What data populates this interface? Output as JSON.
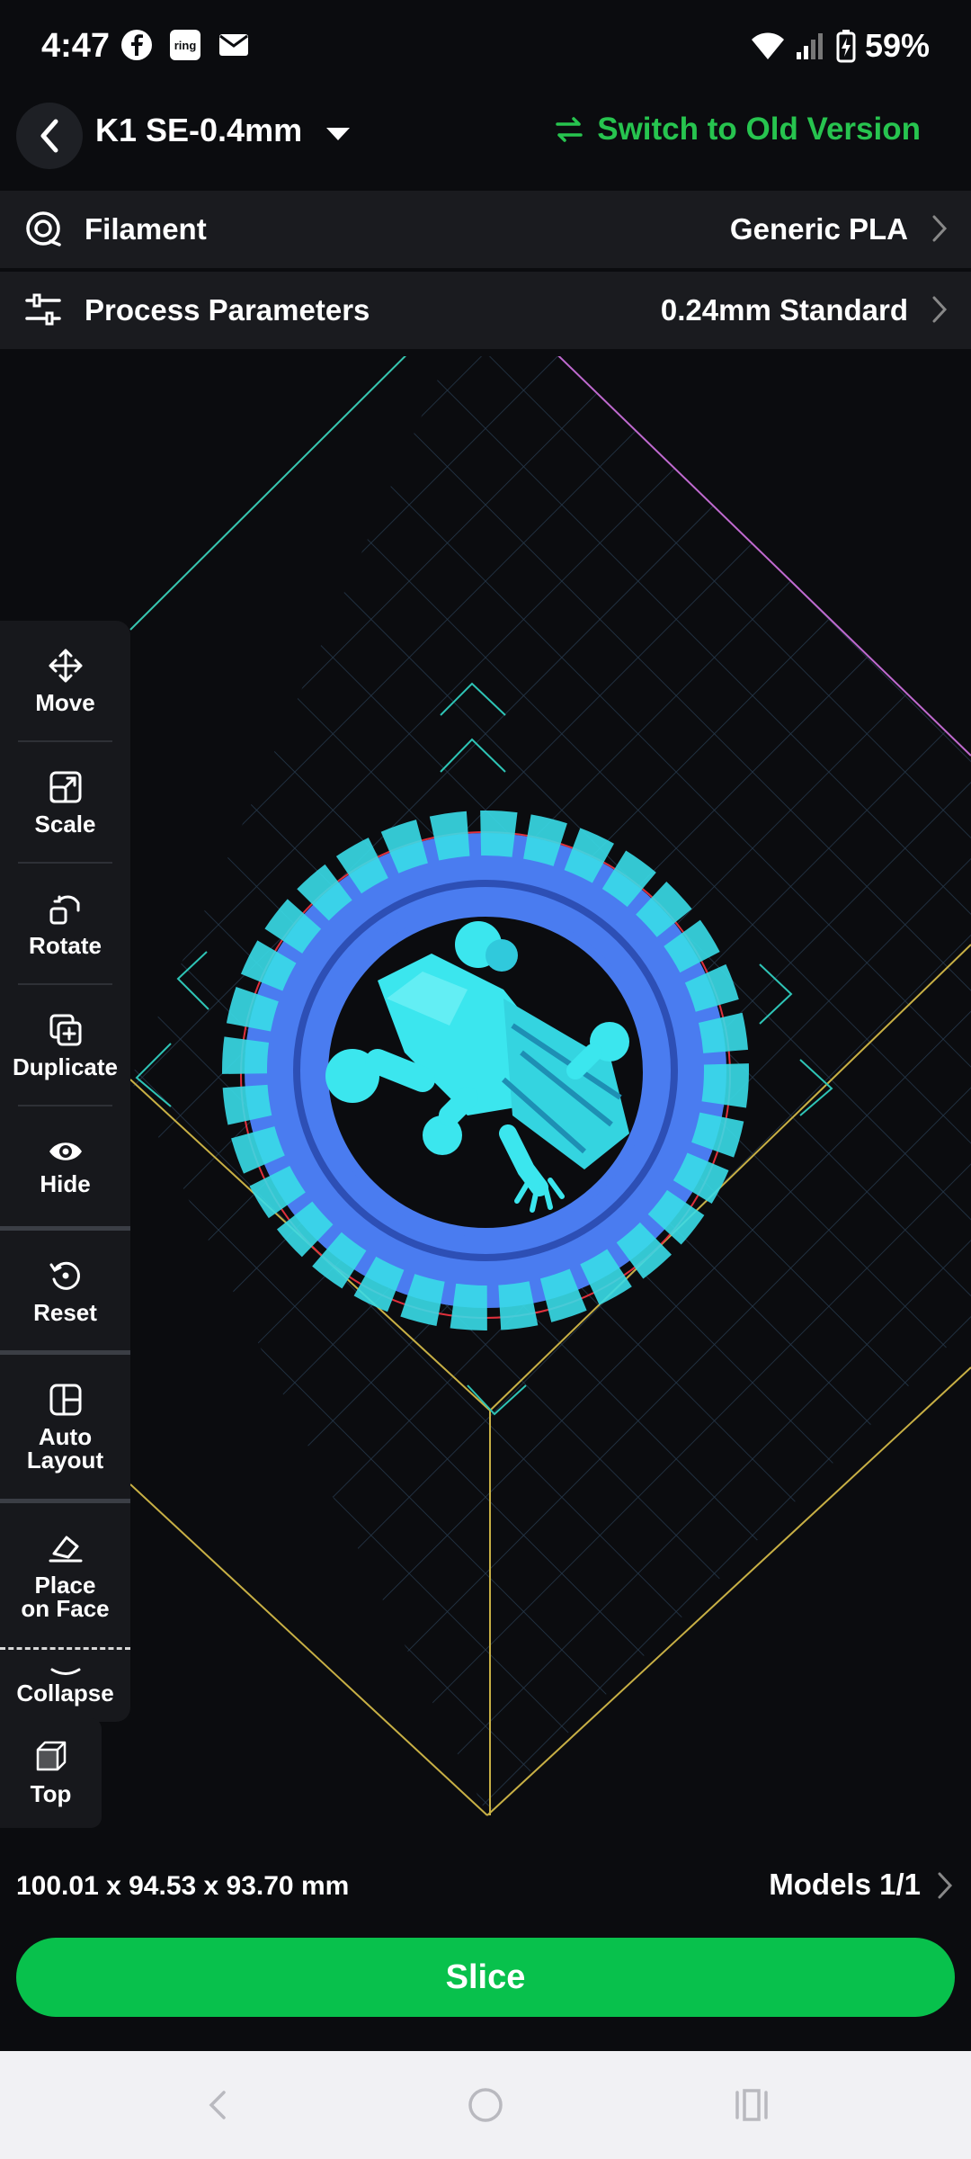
{
  "status": {
    "time": "4:47",
    "battery": "59%"
  },
  "header": {
    "printer": "K1 SE-0.4mm",
    "switch_label": "Switch to Old Version"
  },
  "filament": {
    "label": "Filament",
    "value": "Generic PLA"
  },
  "process": {
    "label": "Process Parameters",
    "value": "0.24mm Standard"
  },
  "toolbar": {
    "move": "Move",
    "scale": "Scale",
    "rotate": "Rotate",
    "duplicate": "Duplicate",
    "hide": "Hide",
    "reset": "Reset",
    "auto_layout_1": "Auto",
    "auto_layout_2": "Layout",
    "place_face_1": "Place",
    "place_face_2": "on Face",
    "collapse": "Collapse"
  },
  "view": {
    "top": "Top"
  },
  "footer": {
    "dimensions": "100.01 x 94.53 x 93.70 mm",
    "models": "Models  1/1"
  },
  "slice_label": "Slice",
  "colors": {
    "accent_green": "#27c44f",
    "slice_green": "#08c14c",
    "model_blue": "#4a7cf0",
    "model_cyan": "#3be6ee"
  }
}
